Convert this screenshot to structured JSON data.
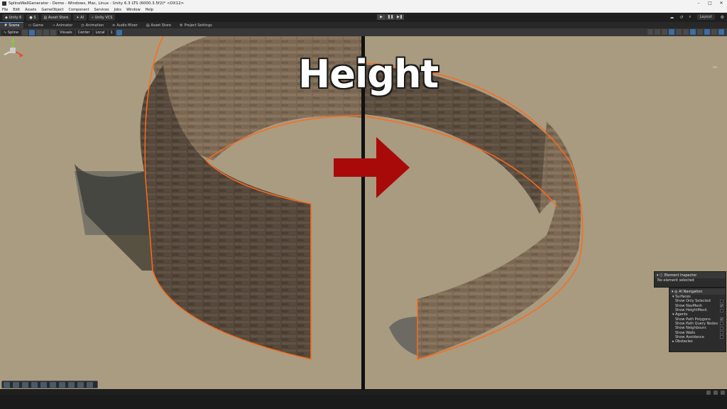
{
  "window": {
    "title": "SplineWallGenerator - Demo - Windows, Mac, Linux - Unity 6.3 LTS (6000.3.5f2)* <DX12>",
    "controls": [
      "–",
      "□",
      "✕"
    ]
  },
  "menu": [
    "File",
    "Edit",
    "Assets",
    "GameObject",
    "Component",
    "Services",
    "Jobs",
    "Window",
    "Help"
  ],
  "toolbar": {
    "unity_label": "Unity 6",
    "account_label": "S",
    "asset_store_label": "Asset Store",
    "ai_label": "AI",
    "vcs_label": "Unity VCS",
    "layout_label": "Layout",
    "play_icons": [
      "▶",
      "❚❚",
      "▶❚"
    ]
  },
  "tabs": [
    {
      "label": "Scene",
      "icon": "#",
      "active": true
    },
    {
      "label": "Game",
      "icon": "▭",
      "active": false
    },
    {
      "label": "Animator",
      "icon": "⇢",
      "active": false
    },
    {
      "label": "Animation",
      "icon": "◷",
      "active": false
    },
    {
      "label": "Audio Mixer",
      "icon": "≋",
      "active": false
    },
    {
      "label": "Asset Store",
      "icon": "▤",
      "active": false
    },
    {
      "label": "Project Settings",
      "icon": "⚙",
      "active": false
    }
  ],
  "scene_toolbar": {
    "tool_label": "Spline",
    "visuals_label": "Visuals",
    "center_label": "Center",
    "local_label": "Local",
    "snap_value": "1"
  },
  "viewport": {
    "overlay_title": "Height",
    "gizmo_label": "Iso",
    "colors": {
      "ground": "#a89b80",
      "arrow": "#a80a0a",
      "outline": "#ff6a1a"
    }
  },
  "element_inspector": {
    "title": "Element Inspector",
    "body": "No element selected"
  },
  "ai_navigation": {
    "title": "AI Navigation",
    "sections": [
      {
        "name": "Surfaces",
        "rows": [
          {
            "label": "Show Only Selected",
            "checked": false
          },
          {
            "label": "Show NavMesh",
            "checked": true
          },
          {
            "label": "Show HeightMesh",
            "checked": false
          }
        ]
      },
      {
        "name": "Agents",
        "rows": [
          {
            "label": "Show Path Polygons",
            "checked": true
          },
          {
            "label": "Show Path Query Nodes",
            "checked": false
          },
          {
            "label": "Show Neighbours",
            "checked": false
          },
          {
            "label": "Show Walls",
            "checked": false
          },
          {
            "label": "Show Avoidance",
            "checked": false
          }
        ]
      },
      {
        "name": "Obstacles",
        "rows": []
      }
    ]
  }
}
